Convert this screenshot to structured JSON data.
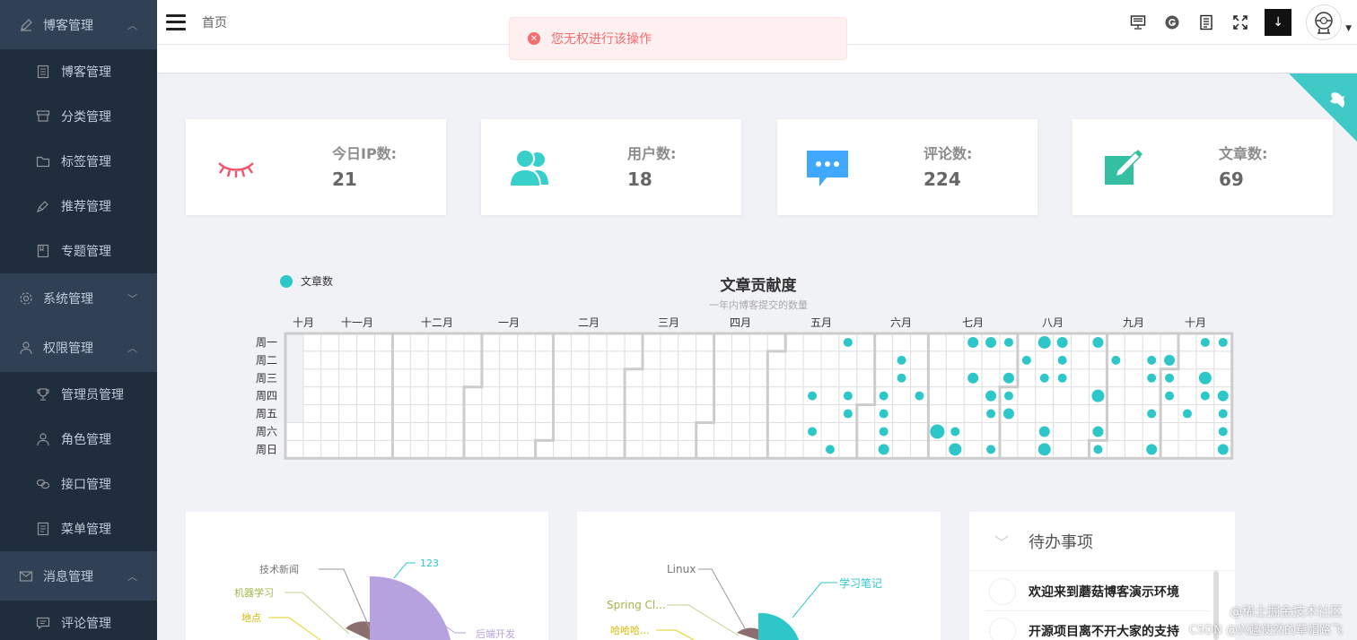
{
  "sidebar": {
    "groups": [
      {
        "title": "博客管理",
        "icon": "edit-icon",
        "expanded": true,
        "items": [
          {
            "label": "博客管理",
            "icon": "document-icon"
          },
          {
            "label": "分类管理",
            "icon": "category-icon"
          },
          {
            "label": "标签管理",
            "icon": "folder-icon"
          },
          {
            "label": "推荐管理",
            "icon": "pen-icon"
          },
          {
            "label": "专题管理",
            "icon": "notebook-icon"
          }
        ]
      },
      {
        "title": "系统管理",
        "icon": "gear-icon",
        "expanded": false,
        "items": []
      },
      {
        "title": "权限管理",
        "icon": "user-icon",
        "expanded": true,
        "items": [
          {
            "label": "管理员管理",
            "icon": "trophy-icon"
          },
          {
            "label": "角色管理",
            "icon": "user-icon"
          },
          {
            "label": "接口管理",
            "icon": "link-icon"
          },
          {
            "label": "菜单管理",
            "icon": "list-icon"
          }
        ]
      },
      {
        "title": "消息管理",
        "icon": "mail-icon",
        "expanded": true,
        "items": [
          {
            "label": "评论管理",
            "icon": "comment-icon"
          }
        ]
      }
    ]
  },
  "header": {
    "breadcrumb": "首页"
  },
  "toast": {
    "message": "您无权进行该操作",
    "type": "error"
  },
  "stats": [
    {
      "label": "今日IP数:",
      "value": "21",
      "icon": "eye-lash-icon",
      "color": "#f4516c"
    },
    {
      "label": "用户数:",
      "value": "18",
      "icon": "users-icon",
      "color": "#36cfc9"
    },
    {
      "label": "评论数:",
      "value": "224",
      "icon": "message-icon",
      "color": "#40a9ff"
    },
    {
      "label": "文章数:",
      "value": "69",
      "icon": "edit-square-icon",
      "color": "#34bfa3"
    }
  ],
  "contribution": {
    "legend": "文章数",
    "title": "文章贡献度",
    "subtitle": "一年内博客提交的数量",
    "months": [
      "十月",
      "十一月",
      "十二月",
      "一月",
      "二月",
      "三月",
      "四月",
      "五月",
      "六月",
      "七月",
      "八月",
      "九月",
      "十月"
    ],
    "weekdays": [
      "周一",
      "周二",
      "周三",
      "周四",
      "周五",
      "周六",
      "周日"
    ],
    "accent": "#2ec7c9"
  },
  "pie1": {
    "labels": [
      "技术新闻",
      "机器学习",
      "地点",
      "123",
      "后端开发"
    ]
  },
  "pie2": {
    "labels": [
      "Linux",
      "Spring Cl...",
      "哈哈哈...",
      "学习笔记"
    ]
  },
  "todo": {
    "title": "待办事项",
    "items": [
      "欢迎来到蘑菇博客演示环境",
      "开源项目离不开大家的支持"
    ]
  },
  "watermark": {
    "line1": "@稀土掘金技术社区",
    "line2": "CSDN @兴趣使然的草帽路飞"
  }
}
